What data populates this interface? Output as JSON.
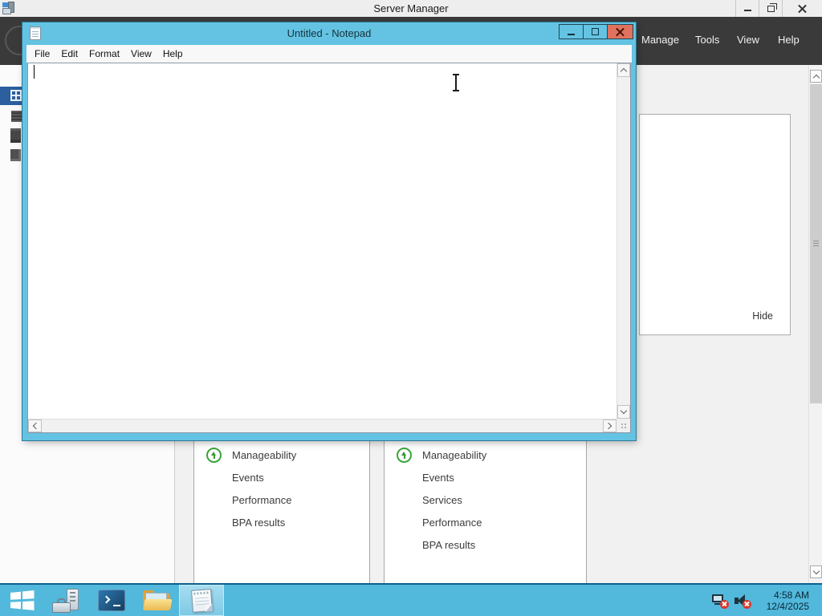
{
  "server_manager": {
    "title": "Server Manager",
    "nav_items": [
      "Manage",
      "Tools",
      "View",
      "Help"
    ],
    "welcome_panel": {
      "hide_label": "Hide"
    },
    "tiles": [
      {
        "status": "Manageability",
        "links": [
          "Events",
          "Performance",
          "BPA results"
        ]
      },
      {
        "status": "Manageability",
        "links": [
          "Events",
          "Services",
          "Performance",
          "BPA results"
        ]
      }
    ]
  },
  "notepad": {
    "title": "Untitled - Notepad",
    "menu_items": [
      "File",
      "Edit",
      "Format",
      "View",
      "Help"
    ],
    "text_content": ""
  },
  "taskbar": {
    "tray": {
      "time": "4:58 AM",
      "date": "12/4/2025"
    }
  },
  "colors": {
    "taskbar_cyan": "#52b8dc",
    "notepad_chrome_cyan": "#64c3e2",
    "close_button_red": "#e0725e",
    "navbar_dark": "#3a3a3a",
    "sidebar_selected_blue": "#2b5f9e",
    "status_green": "#3aa53a",
    "tray_badge_red": "#d8382a"
  }
}
